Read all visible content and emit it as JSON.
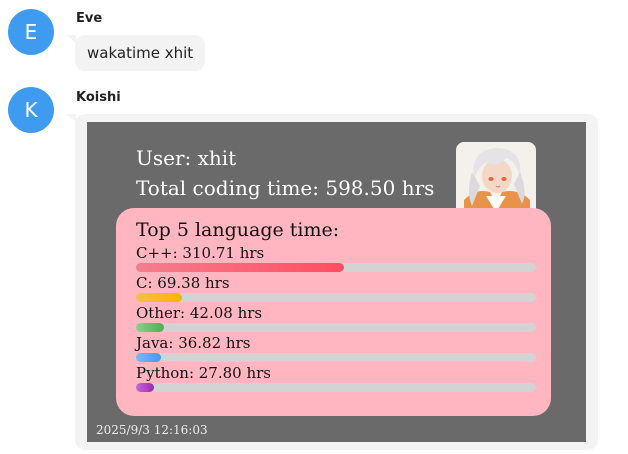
{
  "messages": [
    {
      "sender": "Eve",
      "avatar_letter": "E",
      "text": "wakatime xhit"
    },
    {
      "sender": "Koishi",
      "avatar_letter": "K"
    }
  ],
  "card": {
    "user_line": "User: xhit",
    "total_line": "Total coding time: 598.50 hrs",
    "panel_title": "Top 5 language time:",
    "languages": [
      {
        "label": "C++: 310.71 hrs",
        "fraction": 0.519,
        "color_from": "#f57e8c",
        "color_to": "#ff4d63"
      },
      {
        "label": "C: 69.38 hrs",
        "fraction": 0.116,
        "color_from": "#f5be4e",
        "color_to": "#ffb300"
      },
      {
        "label": "Other: 42.08 hrs",
        "fraction": 0.07,
        "color_from": "#8fce8a",
        "color_to": "#4caf50"
      },
      {
        "label": "Java: 36.82 hrs",
        "fraction": 0.062,
        "color_from": "#7bb8f0",
        "color_to": "#3e9bf0"
      },
      {
        "label": "Python: 27.80 hrs",
        "fraction": 0.046,
        "color_from": "#c16ad6",
        "color_to": "#9c27b0"
      }
    ],
    "timestamp": "2025/9/3 12:16:03"
  }
}
